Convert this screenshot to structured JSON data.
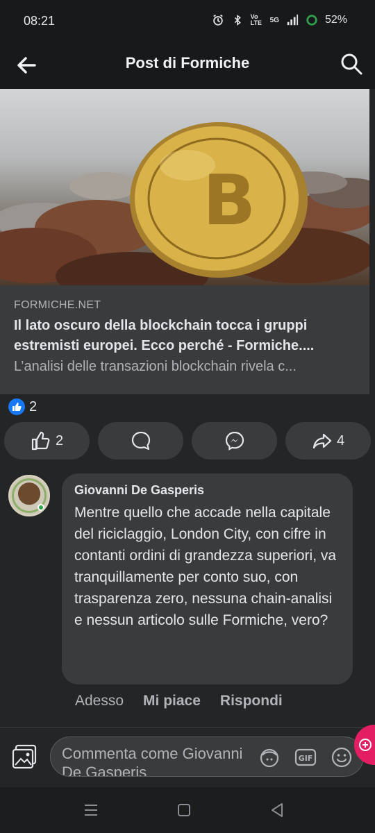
{
  "status_bar": {
    "time": "08:21",
    "network": "5G",
    "volte": "Vo LTE",
    "battery": "52%"
  },
  "header": {
    "title": "Post di Formiche",
    "back_icon": "arrow-left-icon",
    "search_icon": "search-icon"
  },
  "link_card": {
    "image_alt": "bitcoin-coin-image",
    "domain": "FORMICHE.NET",
    "title": "Il lato oscuro della blockchain tocca i gruppi\nestremisti europei. Ecco perché - Formiche....",
    "description": "L’analisi delle transazioni blockchain rivela c..."
  },
  "reactions": {
    "icon": "like-icon",
    "count": "2"
  },
  "actions": [
    {
      "icon": "thumbs-up-icon",
      "label": "2"
    },
    {
      "icon": "comment-icon",
      "label": ""
    },
    {
      "icon": "messenger-icon",
      "label": ""
    },
    {
      "icon": "share-icon",
      "label": "4"
    }
  ],
  "comment": {
    "author": "Giovanni De Gasperis",
    "text": "Mentre quello che accade nella capitale del riciclaggio, London City, con cifre in contanti ordini di grandezza superiori, va tranquillamente per conto suo, con trasparenza zero, nessuna chain-analisi e nessun articolo sulle Formiche, vero?",
    "time": "Adesso",
    "like_label": "Mi piace",
    "reply_label": "Rispondi"
  },
  "composer": {
    "placeholder": "Commenta come Giovanni De Gasperis",
    "icons": [
      "photo-icon",
      "avatar-sticker-icon",
      "gif-icon",
      "emoji-icon"
    ]
  },
  "colors": {
    "background": "#242526",
    "surface": "#3a3b3c",
    "text": "#e4e6eb",
    "secondary_text": "#b0b3b8",
    "like_blue": "#1877f2",
    "chathead_pink": "#e41e63"
  }
}
